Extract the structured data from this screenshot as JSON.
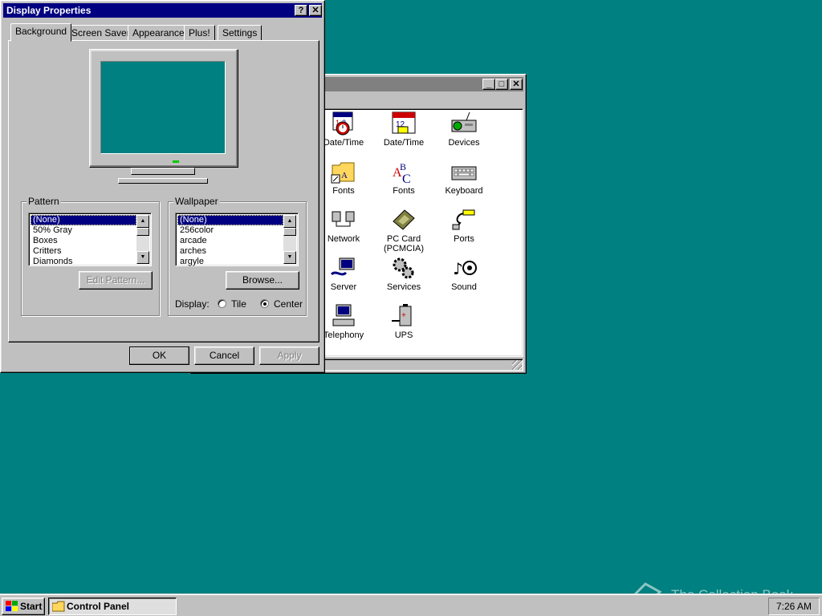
{
  "control_panel": {
    "icons": [
      {
        "label": "Date/Time"
      },
      {
        "label": "Date/Time"
      },
      {
        "label": "Devices"
      },
      {
        "label": "Fonts"
      },
      {
        "label": "Fonts"
      },
      {
        "label": "Keyboard"
      },
      {
        "label": "Network"
      },
      {
        "label": "PC Card (PCMCIA)"
      },
      {
        "label": "Ports"
      },
      {
        "label": "Server"
      },
      {
        "label": "Services"
      },
      {
        "label": "Sound"
      },
      {
        "label": "Telephony"
      },
      {
        "label": "UPS"
      }
    ]
  },
  "dialog": {
    "title": "Display Properties",
    "tabs": [
      "Background",
      "Screen Saver",
      "Appearance",
      "Plus!",
      "Settings"
    ],
    "pattern": {
      "label": "Pattern",
      "items": [
        "(None)",
        "50% Gray",
        "Boxes",
        "Critters",
        "Diamonds"
      ],
      "selected": "(None)",
      "edit_button": "Edit Pattern..."
    },
    "wallpaper": {
      "label": "Wallpaper",
      "items": [
        "(None)",
        "256color",
        "arcade",
        "arches",
        "argyle"
      ],
      "selected": "(None)",
      "browse_button": "Browse..."
    },
    "display": {
      "label": "Display:",
      "tile": "Tile",
      "center": "Center",
      "selected": "Center"
    },
    "buttons": {
      "ok": "OK",
      "cancel": "Cancel",
      "apply": "Apply"
    }
  },
  "taskbar": {
    "start": "Start",
    "task": "Control Panel",
    "clock": "7:26 AM"
  },
  "watermark": "The Collection Book",
  "colors": {
    "desktop": "#008080",
    "titlebar": "#000080",
    "face": "#c0c0c0",
    "preview_screen": "#008080"
  }
}
